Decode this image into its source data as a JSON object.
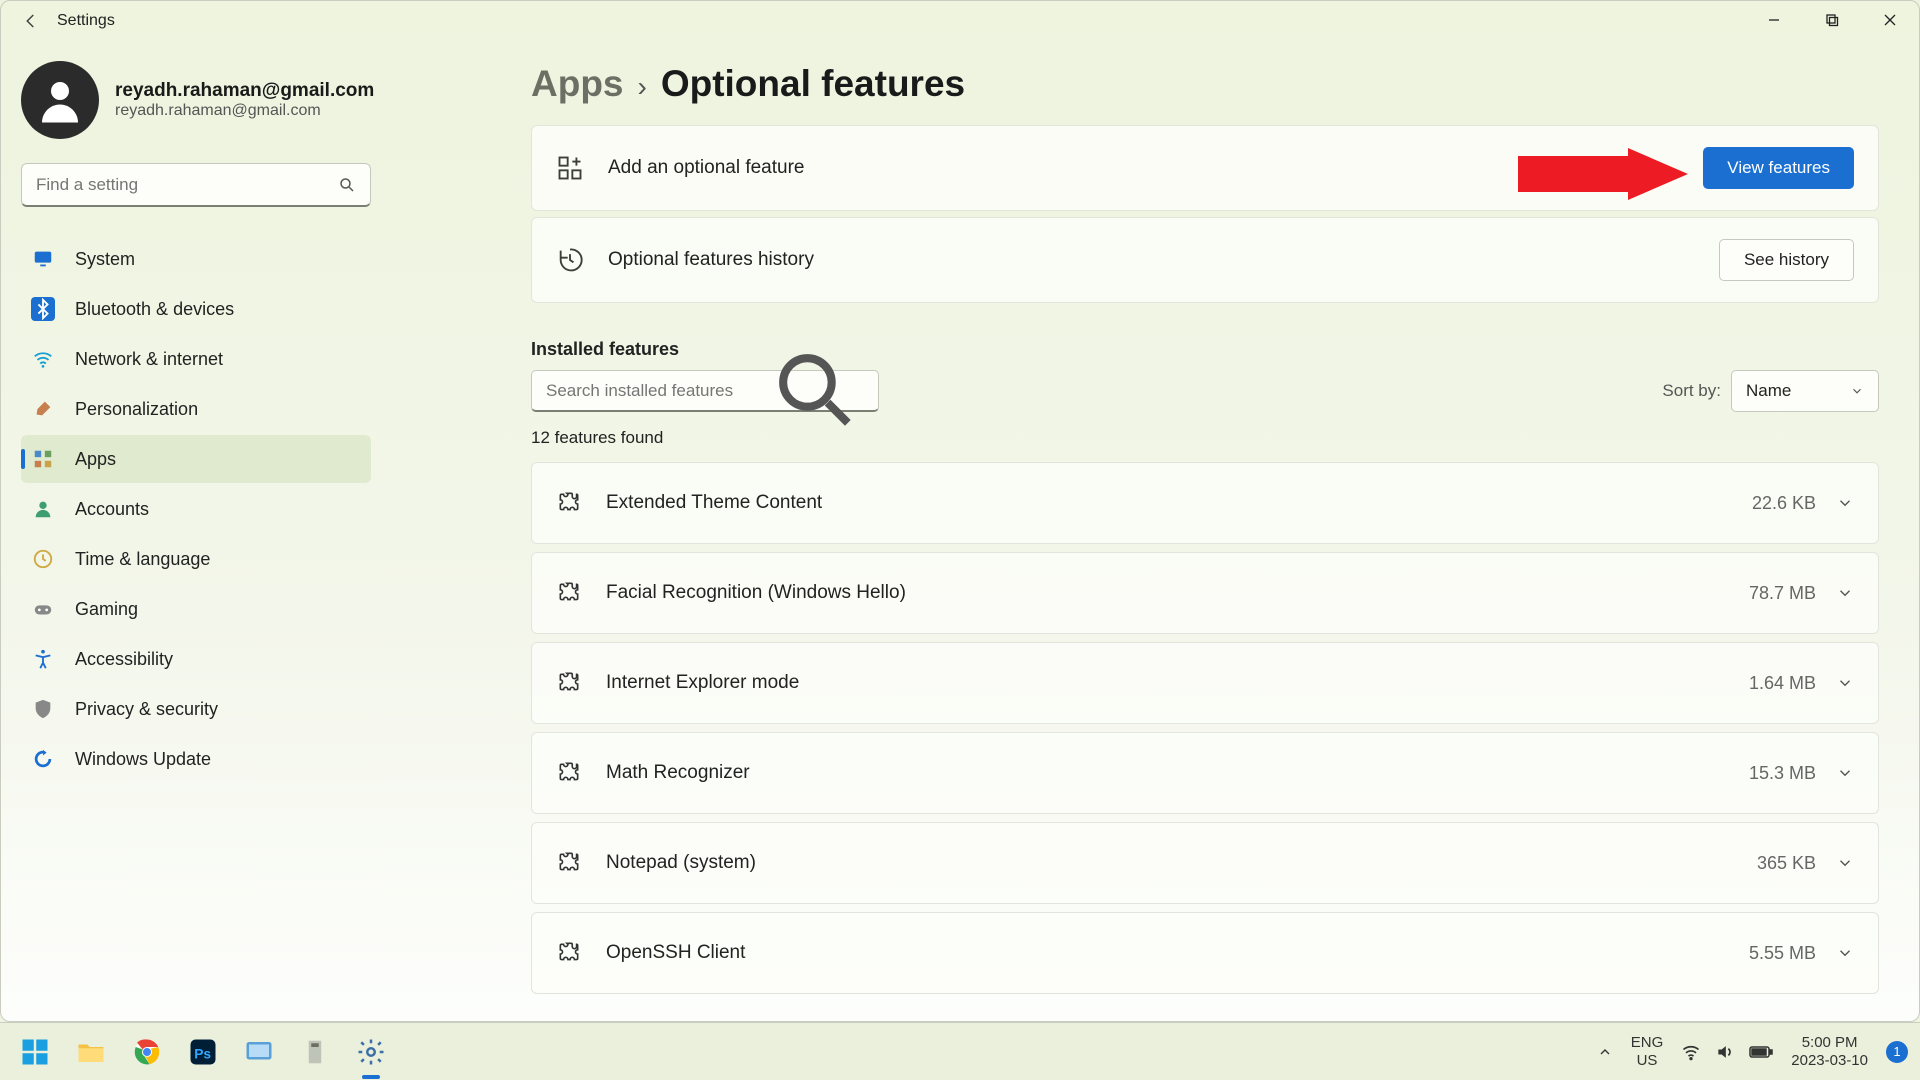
{
  "window": {
    "title": "Settings"
  },
  "account": {
    "email": "reyadh.rahaman@gmail.com",
    "sub": "reyadh.rahaman@gmail.com"
  },
  "sidebar": {
    "search_placeholder": "Find a setting",
    "items": [
      {
        "label": "System",
        "icon": "monitor",
        "color": "#1a6fd1"
      },
      {
        "label": "Bluetooth & devices",
        "icon": "bt",
        "color": "#1a6fd1"
      },
      {
        "label": "Network & internet",
        "icon": "wifi",
        "color": "#1a9fd1"
      },
      {
        "label": "Personalization",
        "icon": "brush",
        "color": "#c77f4d"
      },
      {
        "label": "Apps",
        "icon": "apps",
        "color": "#555"
      },
      {
        "label": "Accounts",
        "icon": "user",
        "color": "#3d9f6f"
      },
      {
        "label": "Time & language",
        "icon": "clock",
        "color": "#cfa842"
      },
      {
        "label": "Gaming",
        "icon": "gaming",
        "color": "#888"
      },
      {
        "label": "Accessibility",
        "icon": "accessibility",
        "color": "#1a6fd1"
      },
      {
        "label": "Privacy & security",
        "icon": "shield",
        "color": "#888"
      },
      {
        "label": "Windows Update",
        "icon": "update",
        "color": "#1a6fd1"
      }
    ],
    "active_index": 4
  },
  "breadcrumb": {
    "parent": "Apps",
    "current": "Optional features"
  },
  "cards": {
    "add": {
      "label": "Add an optional feature",
      "button": "View features"
    },
    "history": {
      "label": "Optional features history",
      "button": "See history"
    }
  },
  "installed": {
    "section_title": "Installed features",
    "search_placeholder": "Search installed features",
    "sort_label": "Sort by:",
    "sort_value": "Name",
    "count_text": "12 features found",
    "features": [
      {
        "name": "Extended Theme Content",
        "size": "22.6 KB"
      },
      {
        "name": "Facial Recognition (Windows Hello)",
        "size": "78.7 MB"
      },
      {
        "name": "Internet Explorer mode",
        "size": "1.64 MB"
      },
      {
        "name": "Math Recognizer",
        "size": "15.3 MB"
      },
      {
        "name": "Notepad (system)",
        "size": "365 KB"
      },
      {
        "name": "OpenSSH Client",
        "size": "5.55 MB"
      }
    ]
  },
  "taskbar": {
    "lang1": "ENG",
    "lang2": "US",
    "time": "5:00 PM",
    "date": "2023-03-10",
    "notif_count": "1"
  }
}
